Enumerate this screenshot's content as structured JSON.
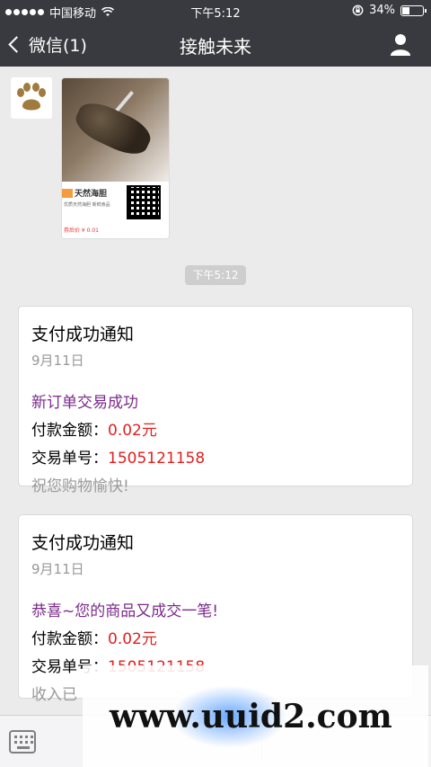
{
  "status_bar": {
    "carrier": "中国移动",
    "time": "下午5:12",
    "battery": "34%"
  },
  "nav": {
    "back_label": "微信(1)",
    "title": "接触未来"
  },
  "image_message": {
    "product_name": "天然海胆",
    "product_sub": "优质天然海胆 新鲜食品",
    "price_label": "券后价 ¥ 0.01"
  },
  "timestamp": "下午5:12",
  "cards": [
    {
      "title": "支付成功通知",
      "date": "9月11日",
      "headline": "新订单交易成功",
      "amount_label": "付款金额：",
      "amount_value": "0.02元",
      "order_label": "交易单号：",
      "order_value": "1505121158",
      "footer": "祝您购物愉快!"
    },
    {
      "title": "支付成功通知",
      "date": "9月11日",
      "headline": "恭喜~您的商品又成交一笔!",
      "amount_label": "付款金额：",
      "amount_value": "0.02元",
      "order_label": "交易单号：",
      "order_value": "1505121158",
      "footer": "收入已"
    }
  ],
  "watermark": "www.uuid2.com",
  "icons": {
    "back": "chevron-left-icon",
    "profile": "person-icon",
    "keyboard": "keyboard-icon",
    "avatar": "paw-icon"
  }
}
